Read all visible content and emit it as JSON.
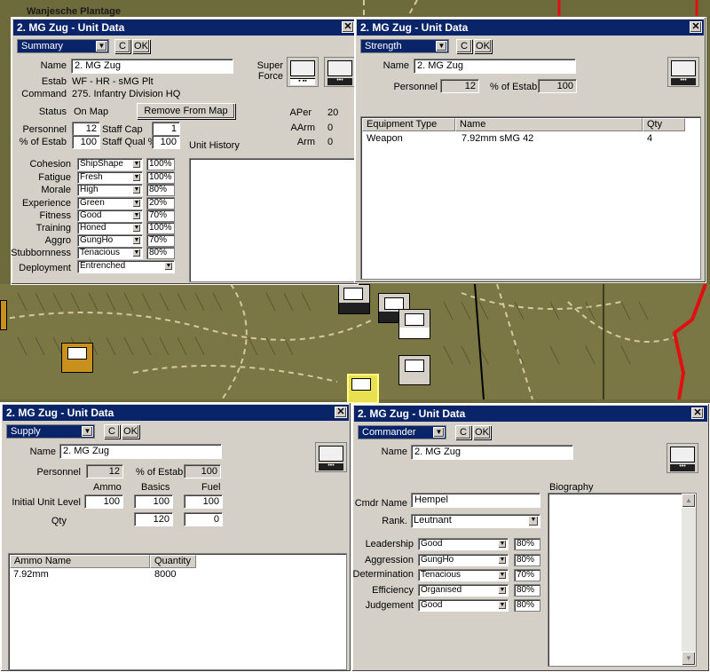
{
  "map": {
    "caption": "Wanjesche Plantage",
    "colors": {
      "terrain": "#6d6a3c",
      "road": "#d8c7a0",
      "front_line": "#e01010",
      "rail": "#000000"
    }
  },
  "windows": {
    "summary": {
      "title": "2. MG Zug - Unit Data",
      "view_select": "Summary",
      "c_btn": "C",
      "ok_btn": "OK",
      "name_label": "Name",
      "name_value": "2. MG Zug",
      "estab_label": "Estab",
      "estab_value": "WF - HR - sMG Plt",
      "command_label": "Command",
      "command_value": "275. Infantry Division HQ",
      "status_label": "Status",
      "status_value": "On Map",
      "remove_btn": "Remove From Map",
      "super_force_label": "Super Force",
      "aper_label": "APer",
      "aper_value": "20",
      "aarm_label": "AArm",
      "aarm_value": "0",
      "arm_label": "Arm",
      "arm_value": "0",
      "personnel_label": "Personnel",
      "personnel_value": "12",
      "estab_pct_label": "% of Estab",
      "estab_pct_value": "100",
      "staff_cap_label": "Staff Cap",
      "staff_cap_value": "1",
      "staff_qual_label": "Staff Qual %",
      "staff_qual_value": "100",
      "unit_history_label": "Unit History",
      "attributes": [
        {
          "label": "Cohesion",
          "value": "ShipShape",
          "pct": "100%"
        },
        {
          "label": "Fatigue",
          "value": "Fresh",
          "pct": "100%"
        },
        {
          "label": "Morale",
          "value": "High",
          "pct": "80%"
        },
        {
          "label": "Experience",
          "value": "Green",
          "pct": "20%"
        },
        {
          "label": "Fitness",
          "value": "Good",
          "pct": "70%"
        },
        {
          "label": "Training",
          "value": "Honed",
          "pct": "100%"
        },
        {
          "label": "Aggro",
          "value": "GungHo",
          "pct": "70%"
        },
        {
          "label": "Stubbornness",
          "value": "Tenacious",
          "pct": "80%"
        }
      ],
      "deployment_label": "Deployment",
      "deployment_value": "Entrenched"
    },
    "strength": {
      "title": "2. MG Zug - Unit Data",
      "view_select": "Strength",
      "c_btn": "C",
      "ok_btn": "OK",
      "name_label": "Name",
      "name_value": "2. MG Zug",
      "personnel_label": "Personnel",
      "personnel_value": "12",
      "estab_pct_label": "% of Estab",
      "estab_pct_value": "100",
      "columns": [
        "Equipment Type",
        "Name",
        "Qty"
      ],
      "rows": [
        {
          "type": "Weapon",
          "name": "7.92mm sMG 42",
          "qty": "4"
        }
      ]
    },
    "supply": {
      "title": "2. MG Zug - Unit Data",
      "view_select": "Supply",
      "c_btn": "C",
      "ok_btn": "OK",
      "name_label": "Name",
      "name_value": "2. MG Zug",
      "personnel_label": "Personnel",
      "personnel_value": "12",
      "estab_pct_label": "% of Estab",
      "estab_pct_value": "100",
      "col_ammo": "Ammo",
      "col_basics": "Basics",
      "col_fuel": "Fuel",
      "initial_label": "Initial Unit Level",
      "initial_ammo": "100",
      "initial_basics": "100",
      "initial_fuel": "100",
      "qty_label": "Qty",
      "qty_basics": "120",
      "qty_fuel": "0",
      "columns": [
        "Ammo Name",
        "Quantity"
      ],
      "rows": [
        {
          "name": "7.92mm",
          "qty": "8000"
        }
      ]
    },
    "commander": {
      "title": "2. MG Zug - Unit Data",
      "view_select": "Commander",
      "c_btn": "C",
      "ok_btn": "OK",
      "name_label": "Name",
      "name_value": "2. MG Zug",
      "cmdr_name_label": "Cmdr Name",
      "cmdr_name_value": "Hempel",
      "rank_label": "Rank",
      "rank_value": "Leutnant",
      "biography_label": "Biography",
      "attributes": [
        {
          "label": "Leadership",
          "value": "Good",
          "pct": "80%"
        },
        {
          "label": "Aggression",
          "value": "GungHo",
          "pct": "80%"
        },
        {
          "label": "Determination",
          "value": "Tenacious",
          "pct": "70%"
        },
        {
          "label": "Efficiency",
          "value": "Organised",
          "pct": "80%"
        },
        {
          "label": "Judgement",
          "value": "Good",
          "pct": "80%"
        }
      ]
    }
  }
}
